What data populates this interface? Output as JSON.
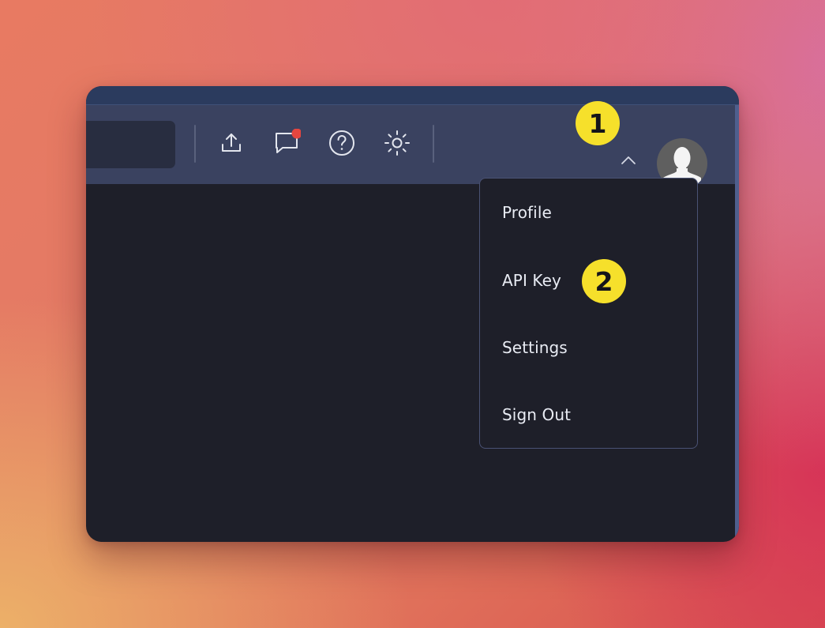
{
  "toolbar": {
    "icons": [
      {
        "name": "upload-icon"
      },
      {
        "name": "chat-notification-icon"
      },
      {
        "name": "help-icon"
      },
      {
        "name": "theme-sun-icon"
      }
    ],
    "notification_dot_color": "#e5463f"
  },
  "user_menu": {
    "chevron_icon": "chevron-up-icon",
    "avatar": "default-user-avatar",
    "items": [
      {
        "label": "Profile"
      },
      {
        "label": "API Key"
      },
      {
        "label": "Settings"
      },
      {
        "label": "Sign Out"
      }
    ]
  },
  "annotations": [
    {
      "label": "1"
    },
    {
      "label": "2"
    }
  ],
  "colors": {
    "window_bg": "#1e1f29",
    "toolbar_bg": "#3a4260",
    "top_strip": "#2b3b5e",
    "badge": "#f6e02b",
    "menu_text": "#e9ecf4"
  }
}
